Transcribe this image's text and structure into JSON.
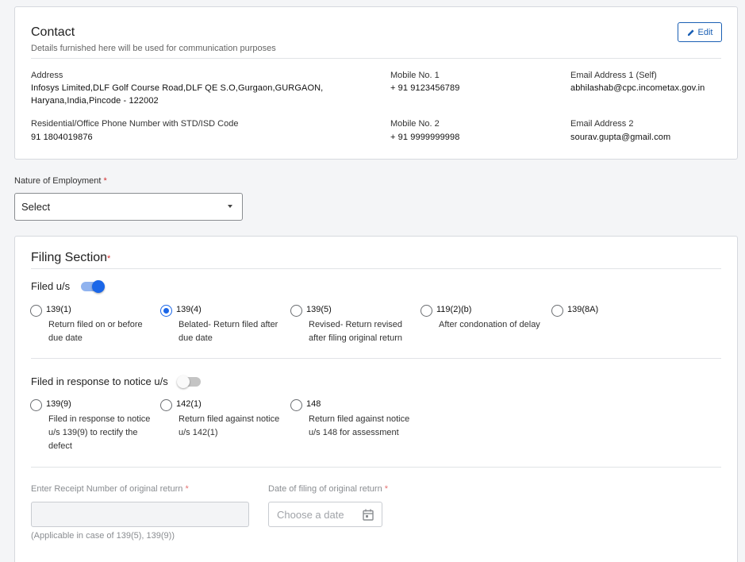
{
  "contact": {
    "title": "Contact",
    "subtitle": "Details furnished here will be used for communication purposes",
    "edit_label": "Edit",
    "address_label": "Address",
    "address_line1": "Infosys Limited,DLF Golf Course Road,DLF QE S.O,Gurgaon,GURGAON,",
    "address_line2": "Haryana,India,Pincode - 122002",
    "mobile1_label": "Mobile No. 1",
    "mobile1_value": "+ 91  9123456789",
    "email1_label": "Email Address 1 (Self)",
    "email1_value": "abhilashab@cpc.incometax.gov.in",
    "phone_label": "Residential/Office Phone Number with STD/ISD Code",
    "phone_value": "91  1804019876",
    "mobile2_label": "Mobile No. 2",
    "mobile2_value": "+ 91  9999999998",
    "email2_label": "Email Address 2",
    "email2_value": "sourav.gupta@gmail.com"
  },
  "employment": {
    "label": "Nature of Employment",
    "required_mark": "*",
    "selected": "Select"
  },
  "filing": {
    "title": "Filing Section",
    "required_mark": "*",
    "filed_us": {
      "label": "Filed u/s",
      "toggle_on": true,
      "options": [
        {
          "code": "139(1)",
          "desc1": "Return filed on or before",
          "desc2": "due date",
          "checked": false
        },
        {
          "code": "139(4)",
          "desc1": "Belated- Return filed after",
          "desc2": "due date",
          "checked": true
        },
        {
          "code": "139(5)",
          "desc1": "Revised- Return revised",
          "desc2": "after filing original return",
          "checked": false
        },
        {
          "code": "119(2)(b)",
          "desc1": "After condonation of delay",
          "desc2": "",
          "checked": false
        },
        {
          "code": "139(8A)",
          "desc1": "",
          "desc2": "",
          "checked": false
        }
      ]
    },
    "notice": {
      "label": "Filed in response to notice u/s",
      "toggle_on": false,
      "options": [
        {
          "code": "139(9)",
          "desc1": "Filed in response to notice",
          "desc2": "u/s 139(9) to rectify the",
          "desc3": "defect"
        },
        {
          "code": "142(1)",
          "desc1": "Return filed against notice",
          "desc2": "u/s 142(1)",
          "desc3": ""
        },
        {
          "code": "148",
          "desc1": "Return filed against notice",
          "desc2": "u/s 148 for assessment",
          "desc3": ""
        }
      ]
    },
    "receipt": {
      "label": "Enter Receipt Number of original return",
      "required_mark": "*",
      "value": "",
      "help": "(Applicable in case of 139(5), 139(9))"
    },
    "date": {
      "label": "Date of filing of original return",
      "required_mark": "*",
      "placeholder": "Choose a date"
    }
  },
  "colors": {
    "primary": "#1a66e8",
    "required": "#d32f2f",
    "border": "#d6d9de"
  }
}
